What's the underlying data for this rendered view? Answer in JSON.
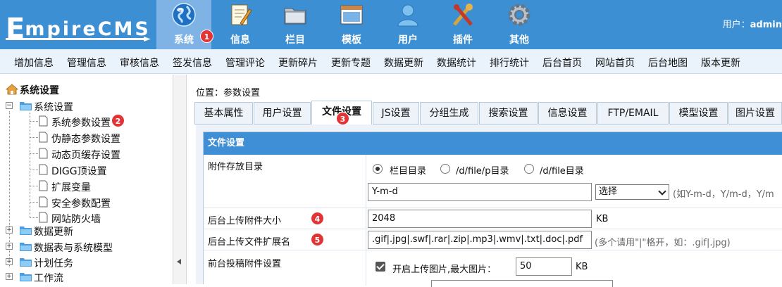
{
  "logo": {
    "first_letter": "E",
    "rest": "mpireCMS"
  },
  "nav": {
    "items": [
      {
        "label": "系统",
        "icon": "globe-icon",
        "active": true,
        "badge": "1"
      },
      {
        "label": "信息",
        "icon": "document-edit-icon"
      },
      {
        "label": "栏目",
        "icon": "folder-icon"
      },
      {
        "label": "模板",
        "icon": "template-window-icon"
      },
      {
        "label": "用户",
        "icon": "user-icon"
      },
      {
        "label": "插件",
        "icon": "tools-icon"
      },
      {
        "label": "其他",
        "icon": "gear-icon"
      }
    ],
    "user_prefix": "用户：",
    "user_name": "admin"
  },
  "subnav": {
    "items": [
      "增加信息",
      "管理信息",
      "审核信息",
      "签发信息",
      "管理评论",
      "更新碎片",
      "更新专题",
      "数据更新",
      "数据统计",
      "排行统计",
      "后台首页",
      "网站首页",
      "后台地图",
      "版本更新"
    ]
  },
  "sidebar": {
    "root": "系统设置",
    "groups": [
      {
        "label": "系统设置",
        "expanded": true,
        "children": [
          "系统参数设置",
          "伪静态参数设置",
          "动态页缓存设置",
          "DIGG顶设置",
          "扩展变量",
          "安全参数配置",
          "网站防火墙"
        ]
      },
      {
        "label": "数据更新"
      },
      {
        "label": "数据表与系统模型"
      },
      {
        "label": "计划任务"
      },
      {
        "label": "工作流"
      }
    ],
    "badge_on_child": "2"
  },
  "main": {
    "location": "位置：参数设置",
    "tabs": [
      "基本属性",
      "用户设置",
      "文件设置",
      "JS设置",
      "分组生成",
      "搜索设置",
      "信息设置",
      "FTP/EMAIL",
      "模型设置",
      "图片设置"
    ],
    "active_tab_badge": "3",
    "panel_title": "文件设置",
    "rows": {
      "attach_dir": {
        "label": "附件存放目录",
        "options": [
          "栏目目录",
          "/d/file/p目录",
          "/d/file目录"
        ],
        "selected_option": "栏目目录",
        "date_format": "Y-m-d",
        "select_value": "选择",
        "hint": "(如Y-m-d，Y/m-d，Y/m"
      },
      "upload_size": {
        "label": "后台上传附件大小",
        "badge": "4",
        "value": "2048",
        "unit": "KB"
      },
      "upload_ext": {
        "label": "后台上传文件扩展名",
        "badge": "5",
        "value": ".gif|.jpg|.swf|.rar|.zip|.mp3|.wmv|.txt|.doc|.pdf",
        "hint": "(多个请用\"|\"格开，如：.gif|.jpg)"
      },
      "front_attach": {
        "label": "前台投稿附件设置",
        "check_label": "开启上传图片,最大图片：",
        "value": "50",
        "unit": "KB"
      }
    }
  },
  "colors": {
    "header": "#3c8fd3",
    "active_nav": "#7fb2e5",
    "panel_header": "#3f8fd6",
    "badge": "#e23434"
  }
}
